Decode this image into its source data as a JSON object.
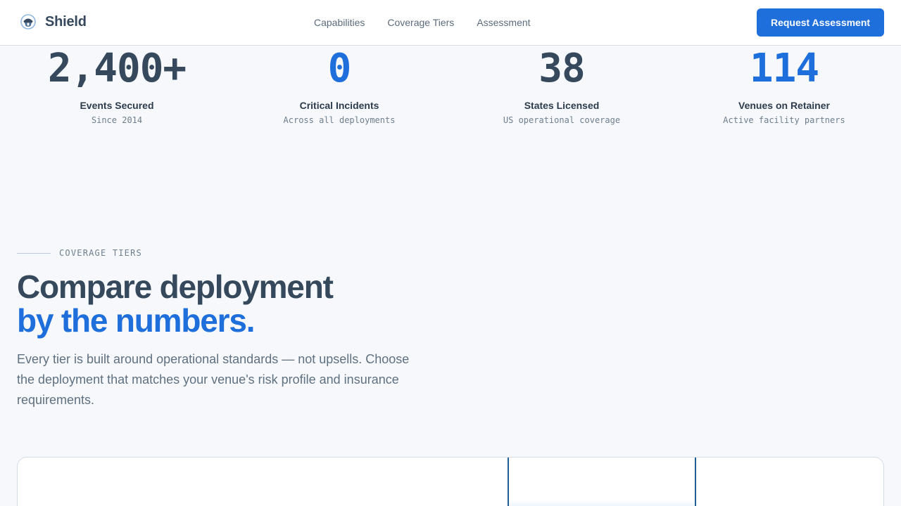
{
  "header": {
    "brand": "Shield",
    "nav": [
      {
        "label": "Capabilities"
      },
      {
        "label": "Coverage Tiers"
      },
      {
        "label": "Assessment"
      }
    ],
    "cta_label": "Request Assessment"
  },
  "stats": [
    {
      "value": "2,400+",
      "label": "Events Secured",
      "sub": "Since 2014"
    },
    {
      "value": "0",
      "label": "Critical Incidents",
      "sub": "Across all deployments"
    },
    {
      "value": "38",
      "label": "States Licensed",
      "sub": "US operational coverage"
    },
    {
      "value": "114",
      "label": "Venues on Retainer",
      "sub": "Active facility partners"
    }
  ],
  "section": {
    "eyebrow": "COVERAGE TIERS",
    "headline_line1": "Compare deployment",
    "headline_line2": "by the numbers.",
    "intro": "Every tier is built around operational standards — not upsells. Choose the deployment that matches your venue's risk profile and insurance requirements."
  },
  "colors": {
    "accent": "#1e6fdc",
    "text_dark": "#36495c",
    "background": "#f6f8fb"
  },
  "icons": {
    "logo": "shield-helmet-icon"
  }
}
